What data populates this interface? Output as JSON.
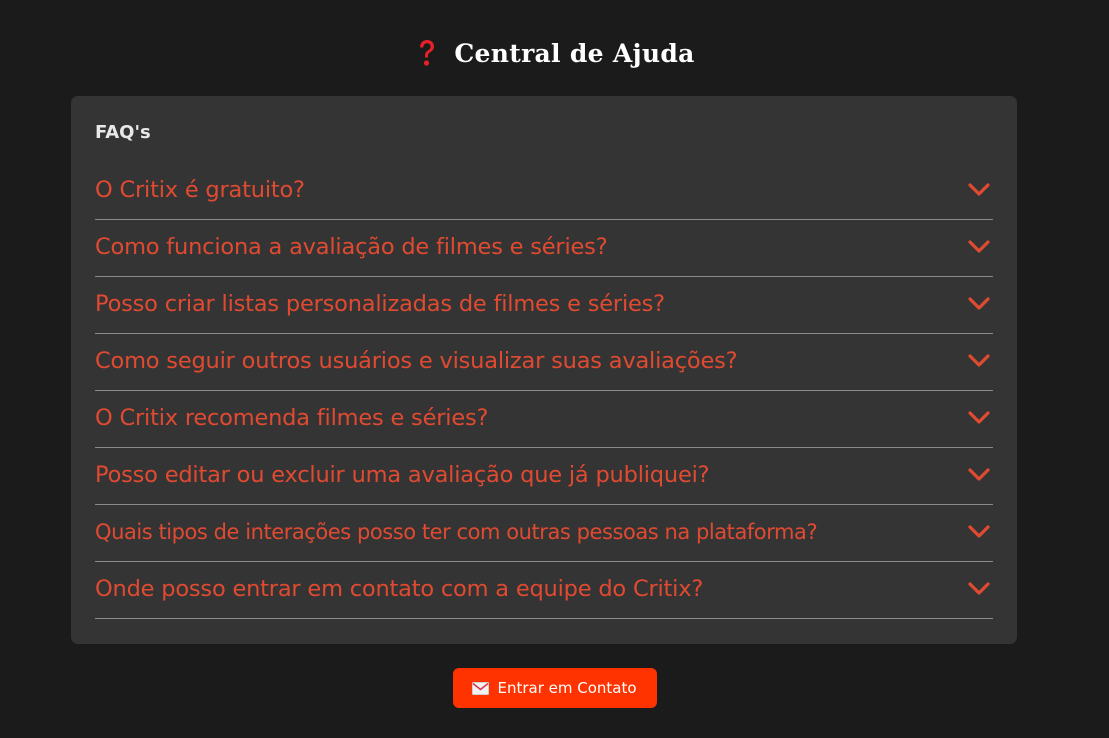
{
  "header": {
    "icon": "red-question-mark-icon",
    "title": "Central de Ajuda"
  },
  "faq": {
    "label": "FAQ's",
    "items": [
      {
        "question": "O Critix é gratuito?"
      },
      {
        "question": "Como funciona a avaliação de filmes e séries?"
      },
      {
        "question": "Posso criar listas personalizadas de filmes e séries?"
      },
      {
        "question": "Como seguir outros usuários e visualizar suas avaliações?"
      },
      {
        "question": "O Critix recomenda filmes e séries?"
      },
      {
        "question": "Posso editar ou excluir uma avaliação que já publiquei?"
      },
      {
        "question": "Quais tipos de interações posso ter com outras pessoas na plataforma?"
      },
      {
        "question": "Onde posso entrar em contato com a equipe do Critix?"
      }
    ]
  },
  "contact": {
    "icon": "envelope-icon",
    "label": "Entrar em Contato"
  },
  "colors": {
    "background": "#1b1b1b",
    "panel": "#353434",
    "accent": "#e04a31",
    "button": "#ff3300"
  }
}
